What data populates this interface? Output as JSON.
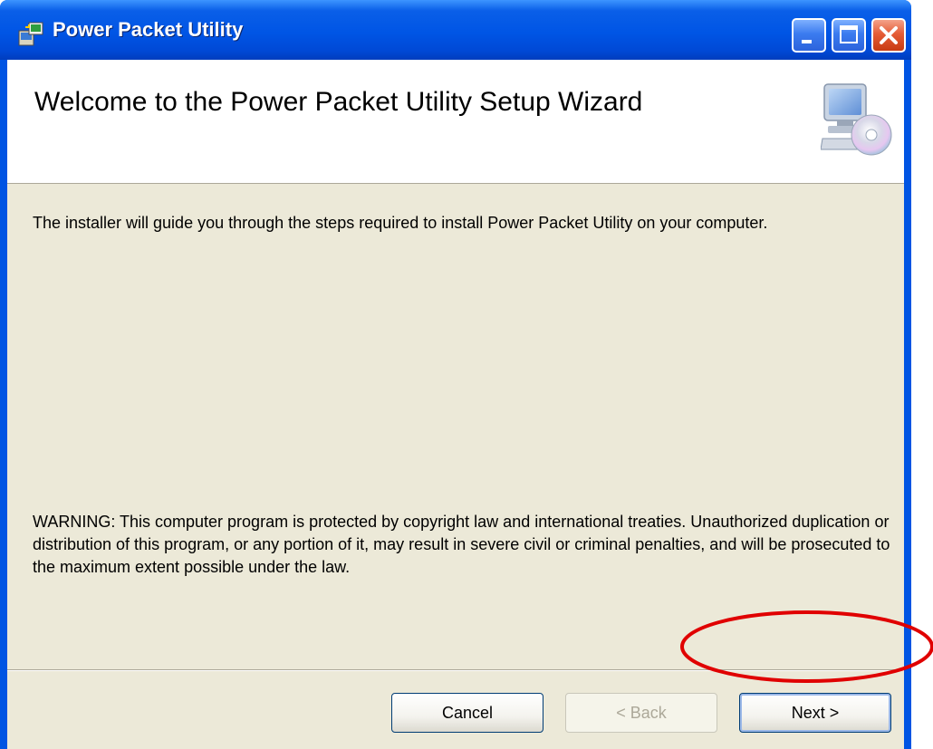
{
  "window": {
    "title": "Power Packet Utility",
    "controls": [
      "minimize-icon",
      "maximize-icon",
      "close-icon"
    ]
  },
  "banner": {
    "title": "Welcome to the Power Packet Utility Setup Wizard",
    "icon": "computer-cd-icon"
  },
  "body": {
    "intro": "The installer will guide you through the steps required to install Power Packet Utility on your computer.",
    "warning": "WARNING: This computer program is protected by copyright law and international treaties. Unauthorized duplication or distribution of this program, or any portion of it, may result in severe civil or criminal penalties, and will be prosecuted to the maximum extent possible under the law."
  },
  "buttons": {
    "cancel": "Cancel",
    "back": "< Back",
    "next": "Next >"
  },
  "colors": {
    "titlebar": "#0055e5",
    "face": "#ece9d8",
    "highlight": "#e00000"
  }
}
